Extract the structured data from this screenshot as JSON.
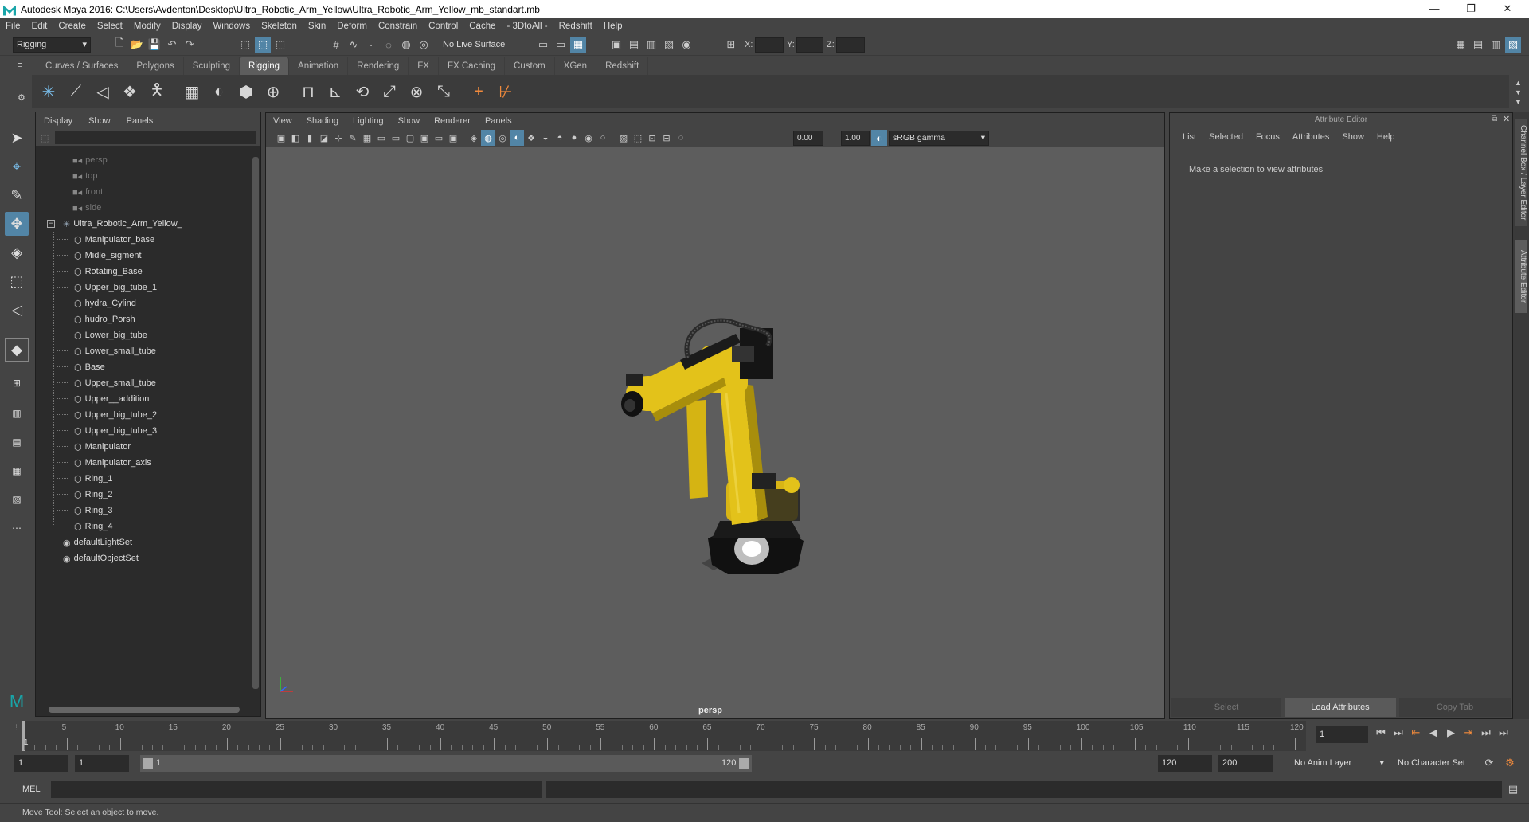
{
  "window": {
    "title": "Autodesk Maya 2016: C:\\Users\\Avdenton\\Desktop\\Ultra_Robotic_Arm_Yellow\\Ultra_Robotic_Arm_Yellow_mb_standart.mb",
    "minimize": "—",
    "maximize": "❐",
    "close": "✕"
  },
  "menubar": [
    "File",
    "Edit",
    "Create",
    "Select",
    "Modify",
    "Display",
    "Windows",
    "Skeleton",
    "Skin",
    "Deform",
    "Constrain",
    "Control",
    "Cache",
    "- 3DtoAll -",
    "Redshift",
    "Help"
  ],
  "statusline": {
    "mode": "Rigging",
    "live_surface": "No Live Surface",
    "x_label": "X:",
    "y_label": "Y:",
    "z_label": "Z:"
  },
  "shelf_tabs": [
    "Curves / Surfaces",
    "Polygons",
    "Sculpting",
    "Rigging",
    "Animation",
    "Rendering",
    "FX",
    "FX Caching",
    "Custom",
    "XGen",
    "Redshift"
  ],
  "shelf_active": "Rigging",
  "outliner": {
    "menu": [
      "Display",
      "Show",
      "Panels"
    ],
    "cameras": [
      "persp",
      "top",
      "front",
      "side"
    ],
    "root": "Ultra_Robotic_Arm_Yellow_",
    "children": [
      "Manipulator_base",
      "Midle_sigment",
      "Rotating_Base",
      "Upper_big_tube_1",
      "hydra_Cylind",
      "hudro_Porsh",
      "Lower_big_tube",
      "Lower_small_tube",
      "Base",
      "Upper_small_tube",
      "Upper__addition",
      "Upper_big_tube_2",
      "Upper_big_tube_3",
      "Manipulator",
      "Manipulator_axis",
      "Ring_1",
      "Ring_2",
      "Ring_3",
      "Ring_4"
    ],
    "sets": [
      "defaultLightSet",
      "defaultObjectSet"
    ]
  },
  "viewport": {
    "menu": [
      "View",
      "Shading",
      "Lighting",
      "Show",
      "Renderer",
      "Panels"
    ],
    "exposure": "0.00",
    "gamma": "1.00",
    "color_space": "sRGB gamma",
    "camera_label": "persp"
  },
  "attribute_editor": {
    "title": "Attribute Editor",
    "menu": [
      "List",
      "Selected",
      "Focus",
      "Attributes",
      "Show",
      "Help"
    ],
    "message": "Make a selection to view attributes",
    "buttons": {
      "select": "Select",
      "load": "Load Attributes",
      "copy": "Copy Tab"
    },
    "side_tabs": [
      "Channel Box / Layer Editor",
      "Attribute Editor"
    ]
  },
  "timeslider": {
    "labels": [
      "5",
      "10",
      "15",
      "20",
      "25",
      "30",
      "35",
      "40",
      "45",
      "50",
      "55",
      "60",
      "65",
      "70",
      "75",
      "80",
      "85",
      "90",
      "95",
      "100",
      "105",
      "110",
      "115",
      "120"
    ],
    "first_label": "1",
    "current_frame": "1"
  },
  "range": {
    "start": "1",
    "playback_start": "1",
    "range_start_label": "1",
    "range_end_label": "120",
    "playback_end": "120",
    "end": "200",
    "anim_layer": "No Anim Layer",
    "character_set": "No Character Set"
  },
  "command": {
    "label": "MEL"
  },
  "helpline": "Move Tool: Select an object to move.",
  "colors": {
    "accent": "#5285a6",
    "viewport_bg": "#5d5d5d",
    "robot_yellow": "#e3c21a"
  }
}
